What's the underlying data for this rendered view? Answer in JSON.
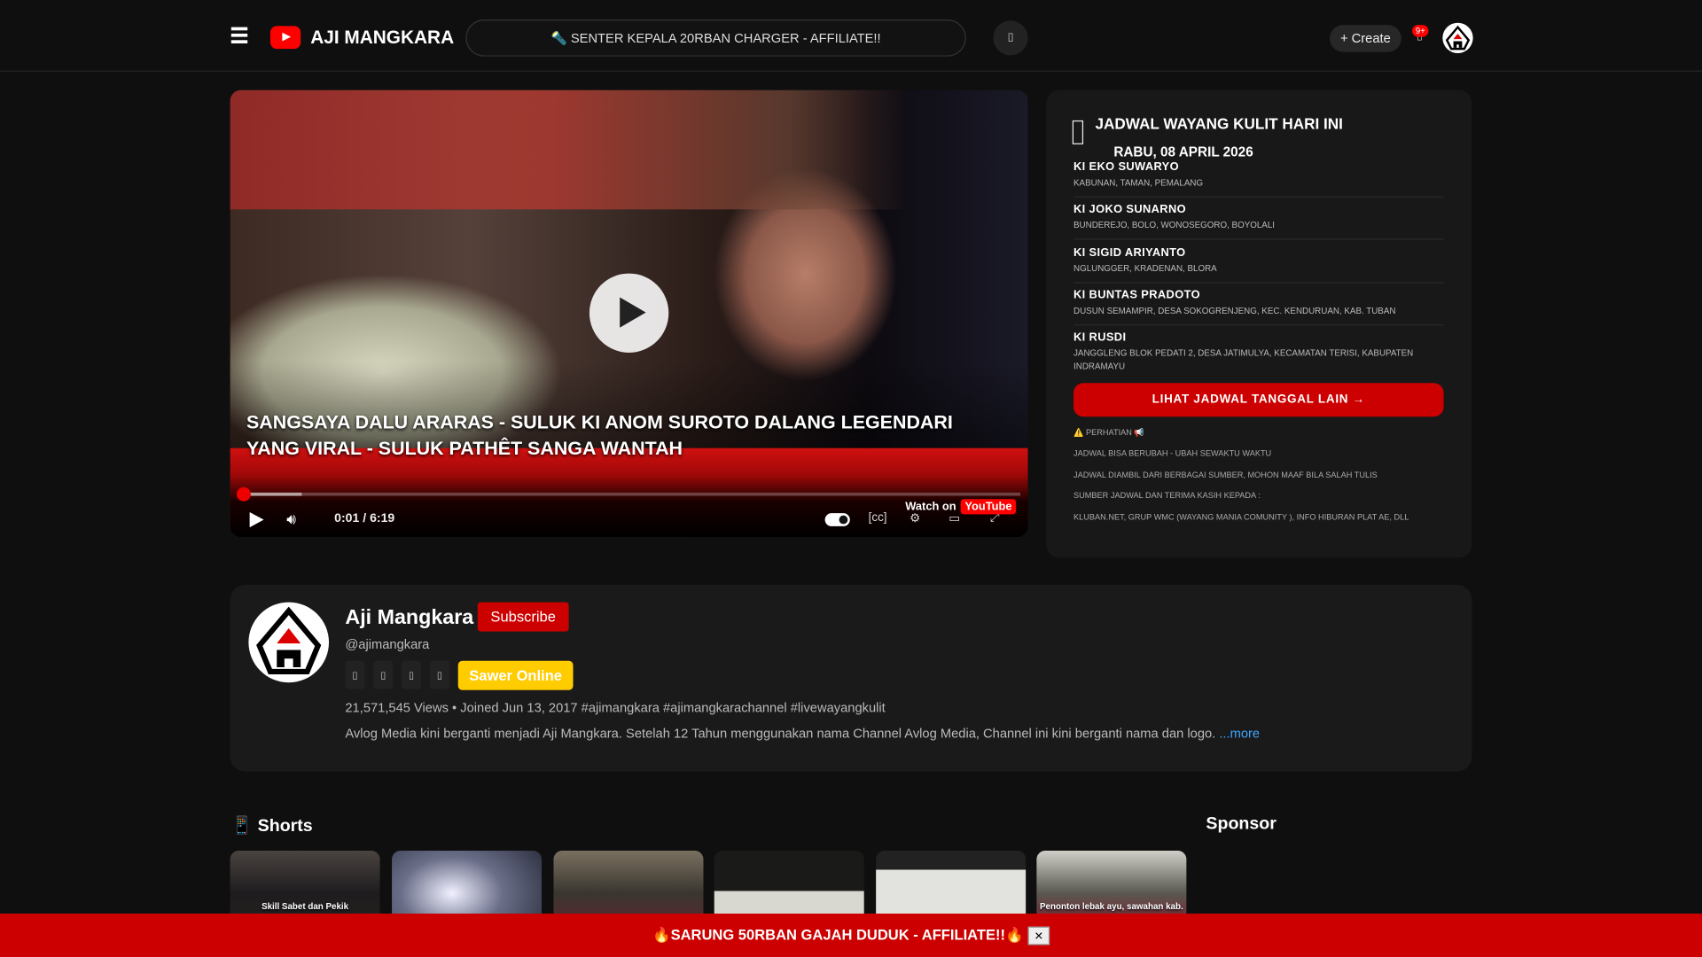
{
  "header": {
    "brand": "AJI MANGKARA",
    "search_text": "🔦 SENTER KEPALA 20RBAN CHARGER - AFFILIATE!!",
    "create_label": "+ Create",
    "notif_badge": "9+"
  },
  "video": {
    "title": "SANGSAYA DALU ARARAS - SULUK KI ANOM SUROTO DALANG LEGENDARI YANG VIRAL - SULUK PATHÊT SANGA WANTAH",
    "time": "0:01 / 6:19",
    "progress_fraction": 0.003,
    "buffered_fraction": 0.08,
    "watch_on": "Watch on",
    "youtube": "YouTube"
  },
  "schedule": {
    "title": "JADWAL WAYANG KULIT HARI INI",
    "date": "RABU, 08 APRIL 2026",
    "items": [
      {
        "name": "KI EKO SUWARYO",
        "place": "KABUNAN, TAMAN, PEMALANG"
      },
      {
        "name": "KI JOKO SUNARNO",
        "place": "BUNDEREJO, BOLO, WONOSEGORO, BOYOLALI"
      },
      {
        "name": "KI SIGID ARIYANTO",
        "place": "NGLUNGGER, KRADENAN, BLORA"
      },
      {
        "name": "KI BUNTAS PRADOTO",
        "place": "DUSUN SEMAMPIR, DESA SOKOGRENJENG, KEC. KENDURUAN, KAB. TUBAN"
      },
      {
        "name": "KI RUSDI",
        "place": "JANGGLENG BLOK PEDATI 2, DESA JATIMULYA, KECAMATAN TERISI, KABUPATEN INDRAMAYU"
      }
    ],
    "more_label": "LIHAT JADWAL TANGGAL LAIN →",
    "notes": [
      "⚠️ PERHATIAN 📢",
      "JADWAL BISA BERUBAH - UBAH SEWAKTU WAKTU",
      "JADWAL DIAMBIL DARI BERBAGAI SUMBER, MOHON MAAF BILA SALAH TULIS",
      "SUMBER JADWAL DAN TERIMA KASIH KEPADA :",
      "KLUBAN.NET, GRUP WMC (WAYANG MANIA COMUNITY ), INFO HIBURAN PLAT AE, DLL"
    ]
  },
  "channel": {
    "name": "Aji Mangkara",
    "subscribe_label": "Subscribe",
    "handle": "@ajimangkara",
    "sawer_label": "Sawer Online",
    "stats": "21,571,545 Views • Joined Jun 13, 2017 #ajimangkara #ajimangkarachannel #livewayangkulit",
    "description": "Avlog Media kini berganti menjadi Aji Mangkara. Setelah 12 Tahun menggunakan nama Channel Avlog Media, Channel ini kini berganti nama dan logo. ",
    "more": "...more"
  },
  "shorts": {
    "title": "📱 Shorts",
    "captions": [
      "Skill Sabet dan Pekik",
      "",
      "",
      "",
      "",
      "Penonton lebak ayu, sawahan kab."
    ]
  },
  "sponsor": {
    "title": "Sponsor"
  },
  "banner": {
    "text": "🔥SARUNG 50RBAN GAJAH DUDUK - AFFILIATE!!🔥",
    "close": "✕"
  },
  "colors": {
    "accent": "#cc0000",
    "sawer": "#ffcc00",
    "link": "#3ea6ff"
  }
}
